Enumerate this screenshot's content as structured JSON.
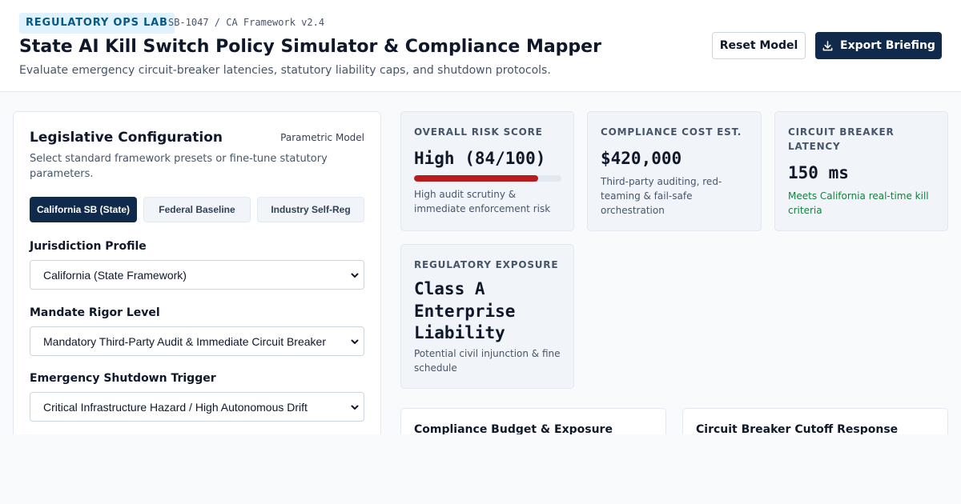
{
  "header": {
    "badge": "REGULATORY OPS LAB",
    "version": "SB-1047 / CA Framework v2.4",
    "title": "State AI Kill Switch Policy Simulator & Compliance Mapper",
    "subtitle": "Evaluate emergency circuit-breaker latencies, statutory liability caps, and shutdown protocols.",
    "reset_label": "Reset Model",
    "export_label": "Export Briefing",
    "export_icon": "download-icon"
  },
  "config": {
    "title": "Legislative Configuration",
    "tag": "Parametric Model",
    "description": "Select standard framework presets or fine-tune statutory parameters.",
    "presets": [
      {
        "label": "California SB (State)",
        "active": true
      },
      {
        "label": "Federal Baseline",
        "active": false
      },
      {
        "label": "Industry Self-Reg",
        "active": false
      }
    ],
    "fields": [
      {
        "label": "Jurisdiction Profile",
        "value": "California (State Framework)"
      },
      {
        "label": "Mandate Rigor Level",
        "value": "Mandatory Third-Party Audit & Immediate Circuit Breaker"
      },
      {
        "label": "Emergency Shutdown Trigger",
        "value": "Critical Infrastructure Hazard / High Autonomous Drift"
      }
    ]
  },
  "kpis": {
    "risk": {
      "label": "OVERALL RISK SCORE",
      "value": "High (84/100)",
      "score_fraction": 0.84,
      "note": "High audit scrutiny & immediate enforcement risk",
      "bar_color": "#b91c1c"
    },
    "cost": {
      "label": "COMPLIANCE COST EST.",
      "value": "$420,000",
      "note": "Third-party auditing, red-teaming & fail-safe orchestration"
    },
    "latency": {
      "label": "CIRCUIT BREAKER LATENCY",
      "value": "150 ms",
      "note": "Meets California real-time kill criteria",
      "note_color": "#15803d"
    },
    "exposure": {
      "label": "REGULATORY EXPOSURE",
      "value": "Class A Enterprise Liability",
      "note": "Potential civil injunction & fine schedule"
    }
  },
  "panels": {
    "budget_title": "Compliance Budget & Exposure",
    "cutoff_title": "Circuit Breaker Cutoff Response"
  },
  "colors": {
    "primary": "#0f2a4a",
    "badge_bg": "#e0f2fe",
    "badge_text": "#075985",
    "danger": "#b91c1c",
    "success": "#15803d"
  }
}
